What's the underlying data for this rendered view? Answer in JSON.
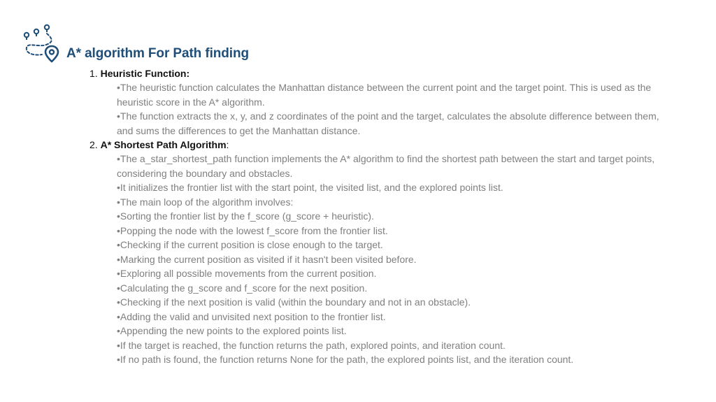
{
  "slide": {
    "title": "A* algorithm For Path finding",
    "accent_color": "#1f4e79",
    "icon": "route-map-pin-icon"
  },
  "sections": [
    {
      "number": "1.",
      "heading": "Heuristic Function:",
      "bullets": [
        "•The heuristic function calculates the Manhattan distance between the current point and the target point. This is used as the heuristic score in the A* algorithm.",
        "•The function extracts the x, y, and z coordinates of the point and the target, calculates the absolute difference between them, and sums the differences to get the Manhattan distance."
      ]
    },
    {
      "number": "2.",
      "heading": "A* Shortest Path Algorithm",
      "heading_suffix": ":",
      "bullets": [
        "•The a_star_shortest_path function implements the A* algorithm to find the shortest path between the start and target points, considering the boundary and obstacles.",
        "•It initializes the frontier list with the start point, the visited list, and the explored points list.",
        "•The main loop of the algorithm involves:",
        "•Sorting the frontier list by the f_score (g_score + heuristic).",
        "•Popping the node with the lowest f_score from the frontier list.",
        "•Checking if the current position is close enough to the target.",
        "•Marking the current position as visited if it hasn't been visited before.",
        "•Exploring all possible movements from the current position.",
        "•Calculating the g_score and f_score for the next position.",
        "•Checking if the next position is valid (within the boundary and not in an obstacle).",
        "•Adding the valid and unvisited next position to the frontier list.",
        "•Appending the new points to the explored points list.",
        "•If the target is reached, the function returns the path, explored points, and iteration count.",
        "•If no path is found, the function returns None for the path, the explored points list, and the iteration count."
      ]
    }
  ]
}
